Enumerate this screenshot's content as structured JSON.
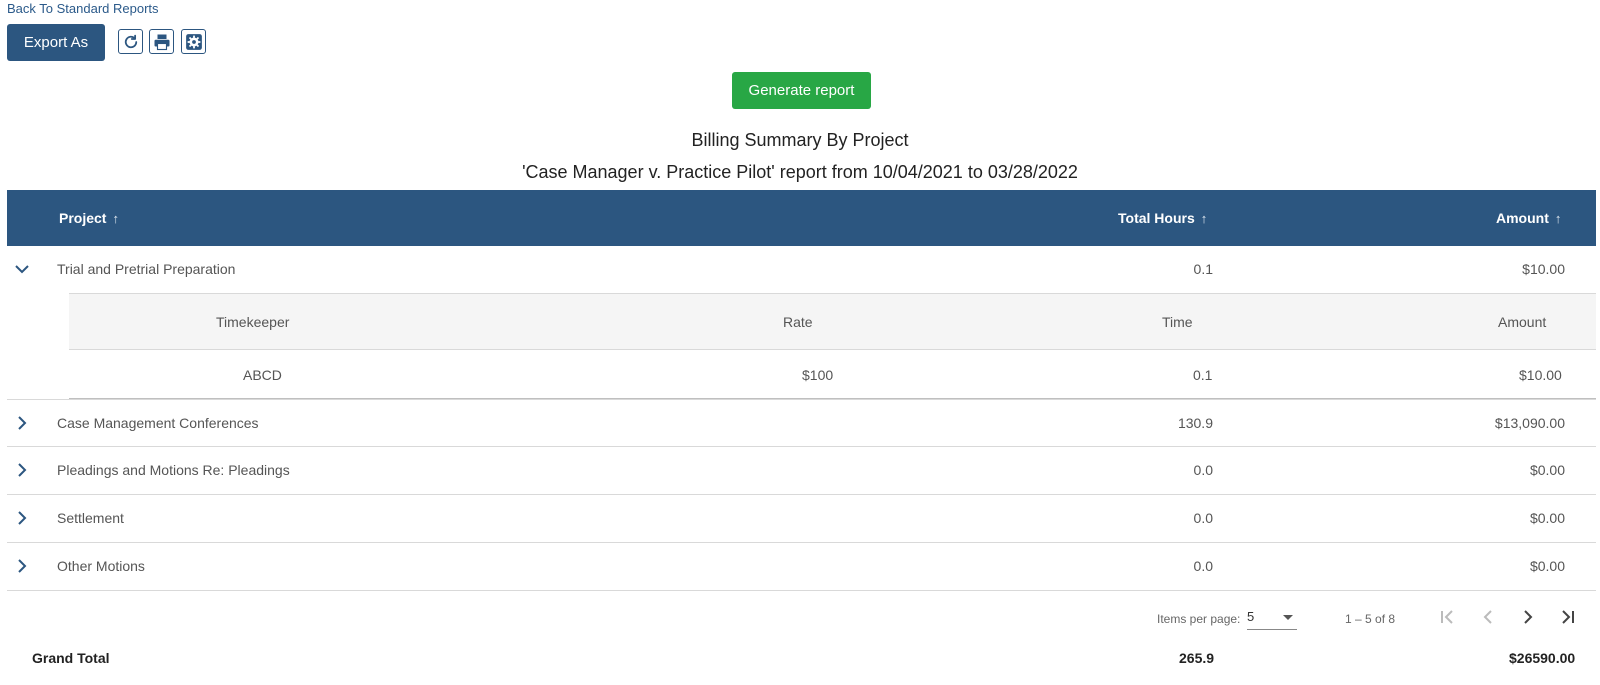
{
  "nav": {
    "back_link": "Back To Standard Reports"
  },
  "toolbar": {
    "export_label": "Export As",
    "icons": [
      "refresh-icon",
      "print-icon",
      "settings-icon"
    ]
  },
  "generate_label": "Generate report",
  "report": {
    "title": "Billing Summary By Project",
    "subtitle": "'Case Manager v. Practice Pilot' report from 10/04/2021 to 03/28/2022"
  },
  "table": {
    "headers": {
      "project": "Project",
      "total_hours": "Total Hours",
      "amount": "Amount"
    },
    "rows": [
      {
        "project": "Trial and Pretrial Preparation",
        "hours": "0.1",
        "amount": "$10.00",
        "expanded": true
      },
      {
        "project": "Case Management Conferences",
        "hours": "130.9",
        "amount": "$13,090.00",
        "expanded": false
      },
      {
        "project": "Pleadings and Motions Re: Pleadings",
        "hours": "0.0",
        "amount": "$0.00",
        "expanded": false
      },
      {
        "project": "Settlement",
        "hours": "0.0",
        "amount": "$0.00",
        "expanded": false
      },
      {
        "project": "Other Motions",
        "hours": "0.0",
        "amount": "$0.00",
        "expanded": false
      }
    ],
    "detail": {
      "headers": {
        "timekeeper": "Timekeeper",
        "rate": "Rate",
        "time": "Time",
        "amount": "Amount"
      },
      "rows": [
        {
          "timekeeper": "ABCD",
          "rate": "$100",
          "time": "0.1",
          "amount": "$10.00"
        }
      ]
    }
  },
  "pagination": {
    "items_per_page_label": "Items per page:",
    "items_per_page_value": "5",
    "range_label": "1 – 5 of 8"
  },
  "grand_total": {
    "label": "Grand Total",
    "hours": "265.9",
    "amount": "$26590.00"
  },
  "colors": {
    "header_bg": "#2c5680",
    "generate_bg": "#28a745",
    "link": "#2b5a8a"
  }
}
